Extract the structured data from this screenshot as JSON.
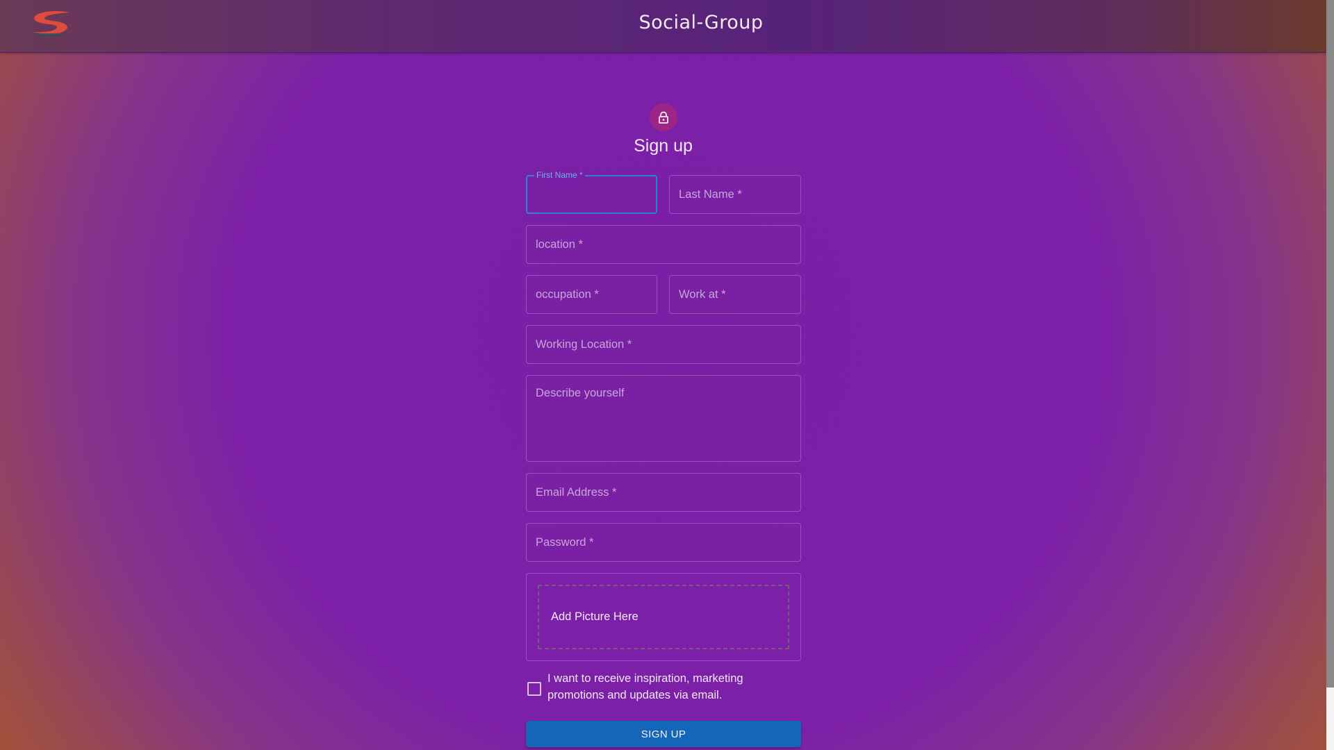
{
  "appbar": {
    "title": "Social-Group",
    "logo_icon": "s-logo-icon",
    "logo_colors": [
      "#e04b3a",
      "#3a4652"
    ]
  },
  "form": {
    "title": "Sign up",
    "lock_icon": "lock-icon",
    "first_name": {
      "label": "First Name *",
      "value": ""
    },
    "last_name": {
      "placeholder": "Last Name *"
    },
    "location": {
      "placeholder": "location *"
    },
    "occupation": {
      "placeholder": "occupation *"
    },
    "work_at": {
      "placeholder": "Work at *"
    },
    "working_location": {
      "placeholder": "Working Location *"
    },
    "describe": {
      "placeholder": "Describe yourself"
    },
    "email": {
      "placeholder": "Email Address *"
    },
    "password": {
      "placeholder": "Password *"
    },
    "picture": {
      "label": "Add Picture Here"
    },
    "marketing_opt_in": {
      "label": "I want to receive inspiration, marketing promotions and updates via email.",
      "checked": false
    },
    "submit_label": "Sign Up"
  },
  "colors": {
    "primary_button": "#1565b8",
    "focus_border": "#2f7fd6",
    "avatar": "#9c2585"
  }
}
